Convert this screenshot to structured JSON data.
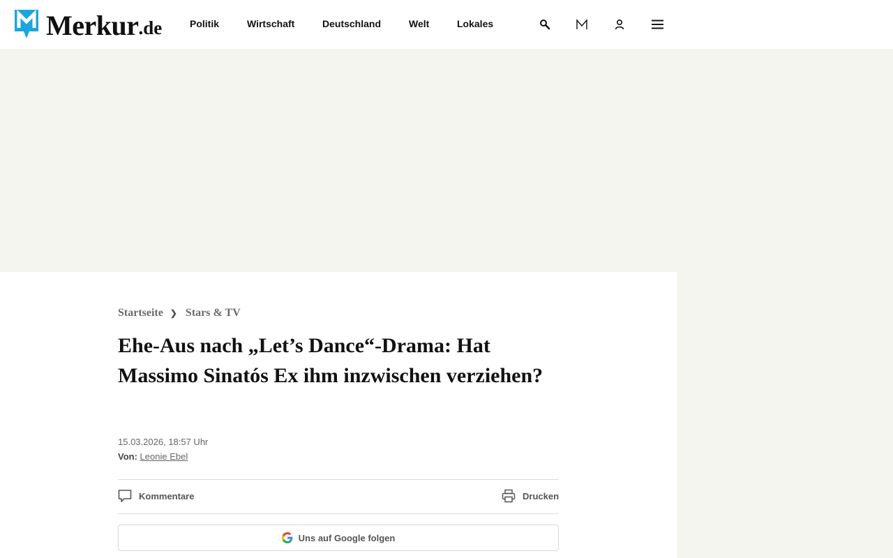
{
  "brand": {
    "name": "Merkur",
    "tld": ".de",
    "color": "#1ba6df"
  },
  "nav": {
    "items": [
      {
        "label": "Politik"
      },
      {
        "label": "Wirtschaft"
      },
      {
        "label": "Deutschland"
      },
      {
        "label": "Welt"
      },
      {
        "label": "Lokales"
      }
    ],
    "icons": [
      "search-icon",
      "merkur-m-icon",
      "user-icon",
      "menu-icon"
    ]
  },
  "breadcrumb": {
    "home": "Startseite",
    "separator": "❯",
    "section": "Stars & TV"
  },
  "article": {
    "headline": "Ehe-Aus nach „Let’s Dance“-Drama: Hat Massimo Sinatós Ex ihm inzwischen verziehen?",
    "date": "15.03.2026, 18:57 Uhr",
    "author_prefix": "Von:",
    "author_name": "Leonie Ebel"
  },
  "actions": {
    "comments_label": "Kommentare",
    "print_label": "Drucken"
  },
  "google_follow": {
    "label": "Uns auf Google folgen"
  },
  "colors": {
    "page_bg": "#f5f5f0",
    "text": "#111111",
    "muted": "#666666"
  }
}
